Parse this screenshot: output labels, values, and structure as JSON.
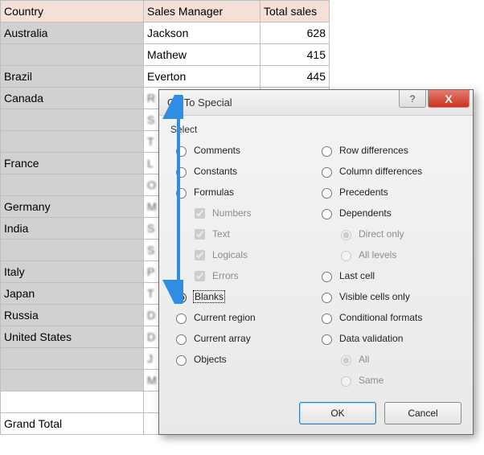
{
  "sheet": {
    "headers": {
      "country": "Country",
      "manager": "Sales Manager",
      "total": "Total sales"
    },
    "rows": [
      {
        "country": "Australia",
        "manager": "Jackson",
        "total": "628"
      },
      {
        "country": "",
        "manager": "Mathew",
        "total": "415"
      },
      {
        "country": "Brazil",
        "manager": "Everton",
        "total": "445"
      },
      {
        "country": "Canada",
        "manager": "R",
        "total": ""
      },
      {
        "country": "",
        "manager": "S",
        "total": ""
      },
      {
        "country": "",
        "manager": "T",
        "total": ""
      },
      {
        "country": "France",
        "manager": "L",
        "total": ""
      },
      {
        "country": "",
        "manager": "O",
        "total": ""
      },
      {
        "country": "Germany",
        "manager": "M",
        "total": ""
      },
      {
        "country": "India",
        "manager": "S",
        "total": ""
      },
      {
        "country": "",
        "manager": "S",
        "total": ""
      },
      {
        "country": "Italy",
        "manager": "P",
        "total": ""
      },
      {
        "country": "Japan",
        "manager": "T",
        "total": ""
      },
      {
        "country": "Russia",
        "manager": "D",
        "total": ""
      },
      {
        "country": "United States",
        "manager": "D",
        "total": ""
      },
      {
        "country": "",
        "manager": "J",
        "total": ""
      },
      {
        "country": "",
        "manager": "M",
        "total": ""
      }
    ],
    "grand_total": "Grand Total"
  },
  "dialog": {
    "title": "Go To Special",
    "help_symbol": "?",
    "close_symbol": "X",
    "select_label": "Select",
    "left": {
      "comments": "Comments",
      "constants": "Constants",
      "formulas": "Formulas",
      "numbers": "Numbers",
      "text": "Text",
      "logicals": "Logicals",
      "errors": "Errors",
      "blanks": "Blanks",
      "current_region": "Current region",
      "current_array": "Current array",
      "objects": "Objects"
    },
    "right": {
      "row_diff": "Row differences",
      "col_diff": "Column differences",
      "precedents": "Precedents",
      "dependents": "Dependents",
      "direct_only": "Direct only",
      "all_levels": "All levels",
      "last_cell": "Last cell",
      "visible_cells": "Visible cells only",
      "cond_formats": "Conditional formats",
      "data_validation": "Data validation",
      "all": "All",
      "same": "Same"
    },
    "buttons": {
      "ok": "OK",
      "cancel": "Cancel"
    }
  }
}
